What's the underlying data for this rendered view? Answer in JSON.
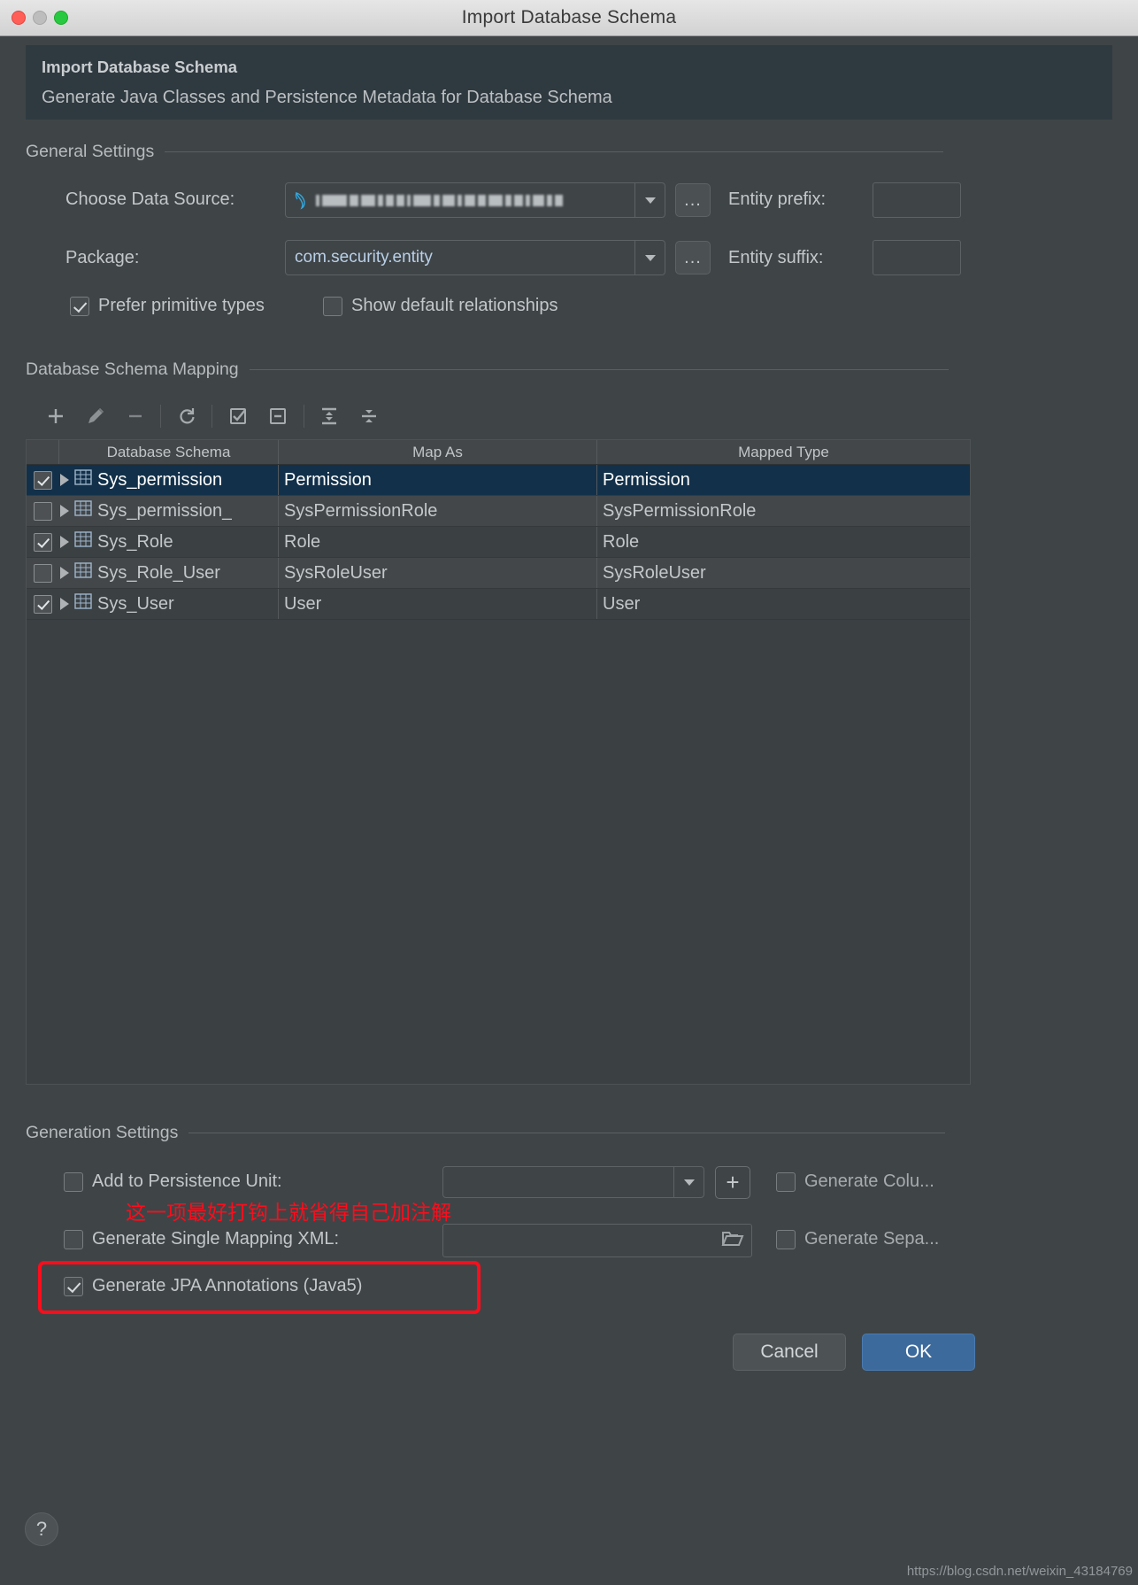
{
  "window": {
    "title": "Import Database Schema",
    "traffic_lights": [
      "close",
      "minimize",
      "zoom"
    ]
  },
  "banner": {
    "title": "Import Database Schema",
    "subtitle": "Generate Java Classes and Persistence Metadata for Database Schema"
  },
  "general_settings": {
    "group_label": "General Settings",
    "data_source_label": "Choose Data Source:",
    "data_source_value": "",
    "data_source_icon": "mysql-dolphin-icon",
    "data_source_browse_label": "...",
    "entity_prefix_label": "Entity prefix:",
    "entity_prefix_value": "",
    "package_label": "Package:",
    "package_value": "com.security.entity",
    "package_browse_label": "...",
    "entity_suffix_label": "Entity suffix:",
    "entity_suffix_value": "",
    "prefer_primitive_types_label": "Prefer primitive types",
    "prefer_primitive_types_checked": true,
    "show_default_relationships_label": "Show default relationships",
    "show_default_relationships_checked": false
  },
  "schema_mapping": {
    "group_label": "Database Schema Mapping",
    "toolbar": [
      {
        "name": "add-button",
        "glyph": "+"
      },
      {
        "name": "edit-button",
        "glyph": "pencil"
      },
      {
        "name": "remove-button",
        "glyph": "−"
      },
      {
        "name": "refresh-button",
        "glyph": "refresh"
      },
      {
        "name": "select-all-button",
        "glyph": "check-box"
      },
      {
        "name": "deselect-all-button",
        "glyph": "minus-box"
      },
      {
        "name": "expand-all-button",
        "glyph": "expand"
      },
      {
        "name": "collapse-all-button",
        "glyph": "collapse"
      }
    ],
    "columns": [
      "",
      "Database Schema",
      "Map As",
      "Mapped Type"
    ],
    "rows": [
      {
        "checked": true,
        "schema": "Sys_permission",
        "map_as": "Permission",
        "mapped_type": "Permission",
        "selected": true
      },
      {
        "checked": false,
        "schema": "Sys_permission_",
        "map_as": "SysPermissionRole",
        "mapped_type": "SysPermissionRole",
        "selected": false
      },
      {
        "checked": true,
        "schema": "Sys_Role",
        "map_as": "Role",
        "mapped_type": "Role",
        "selected": false
      },
      {
        "checked": false,
        "schema": "Sys_Role_User",
        "map_as": "SysRoleUser",
        "mapped_type": "SysRoleUser",
        "selected": false
      },
      {
        "checked": true,
        "schema": "Sys_User",
        "map_as": "User",
        "mapped_type": "User",
        "selected": false
      }
    ]
  },
  "generation_settings": {
    "group_label": "Generation Settings",
    "add_to_persistence_unit_label": "Add to Persistence Unit:",
    "add_to_persistence_unit_checked": false,
    "persistence_unit_value": "",
    "persistence_unit_add_label": "+",
    "generate_columns_label": "Generate Colu...",
    "generate_columns_checked": false,
    "generate_single_mapping_xml_label": "Generate Single Mapping XML:",
    "generate_single_mapping_xml_checked": false,
    "single_mapping_xml_value": "",
    "generate_separate_label": "Generate Sepa...",
    "generate_separate_checked": false,
    "generate_jpa_annotations_label": "Generate JPA Annotations (Java5)",
    "generate_jpa_annotations_checked": true
  },
  "annotations": {
    "chinese_note": "这一项最好打钩上就省得自己加注解",
    "highlight_color": "#fc0d1b"
  },
  "footer": {
    "help_label": "?",
    "cancel_label": "Cancel",
    "ok_label": "OK"
  },
  "watermark": "https://blog.csdn.net/weixin_43184769"
}
